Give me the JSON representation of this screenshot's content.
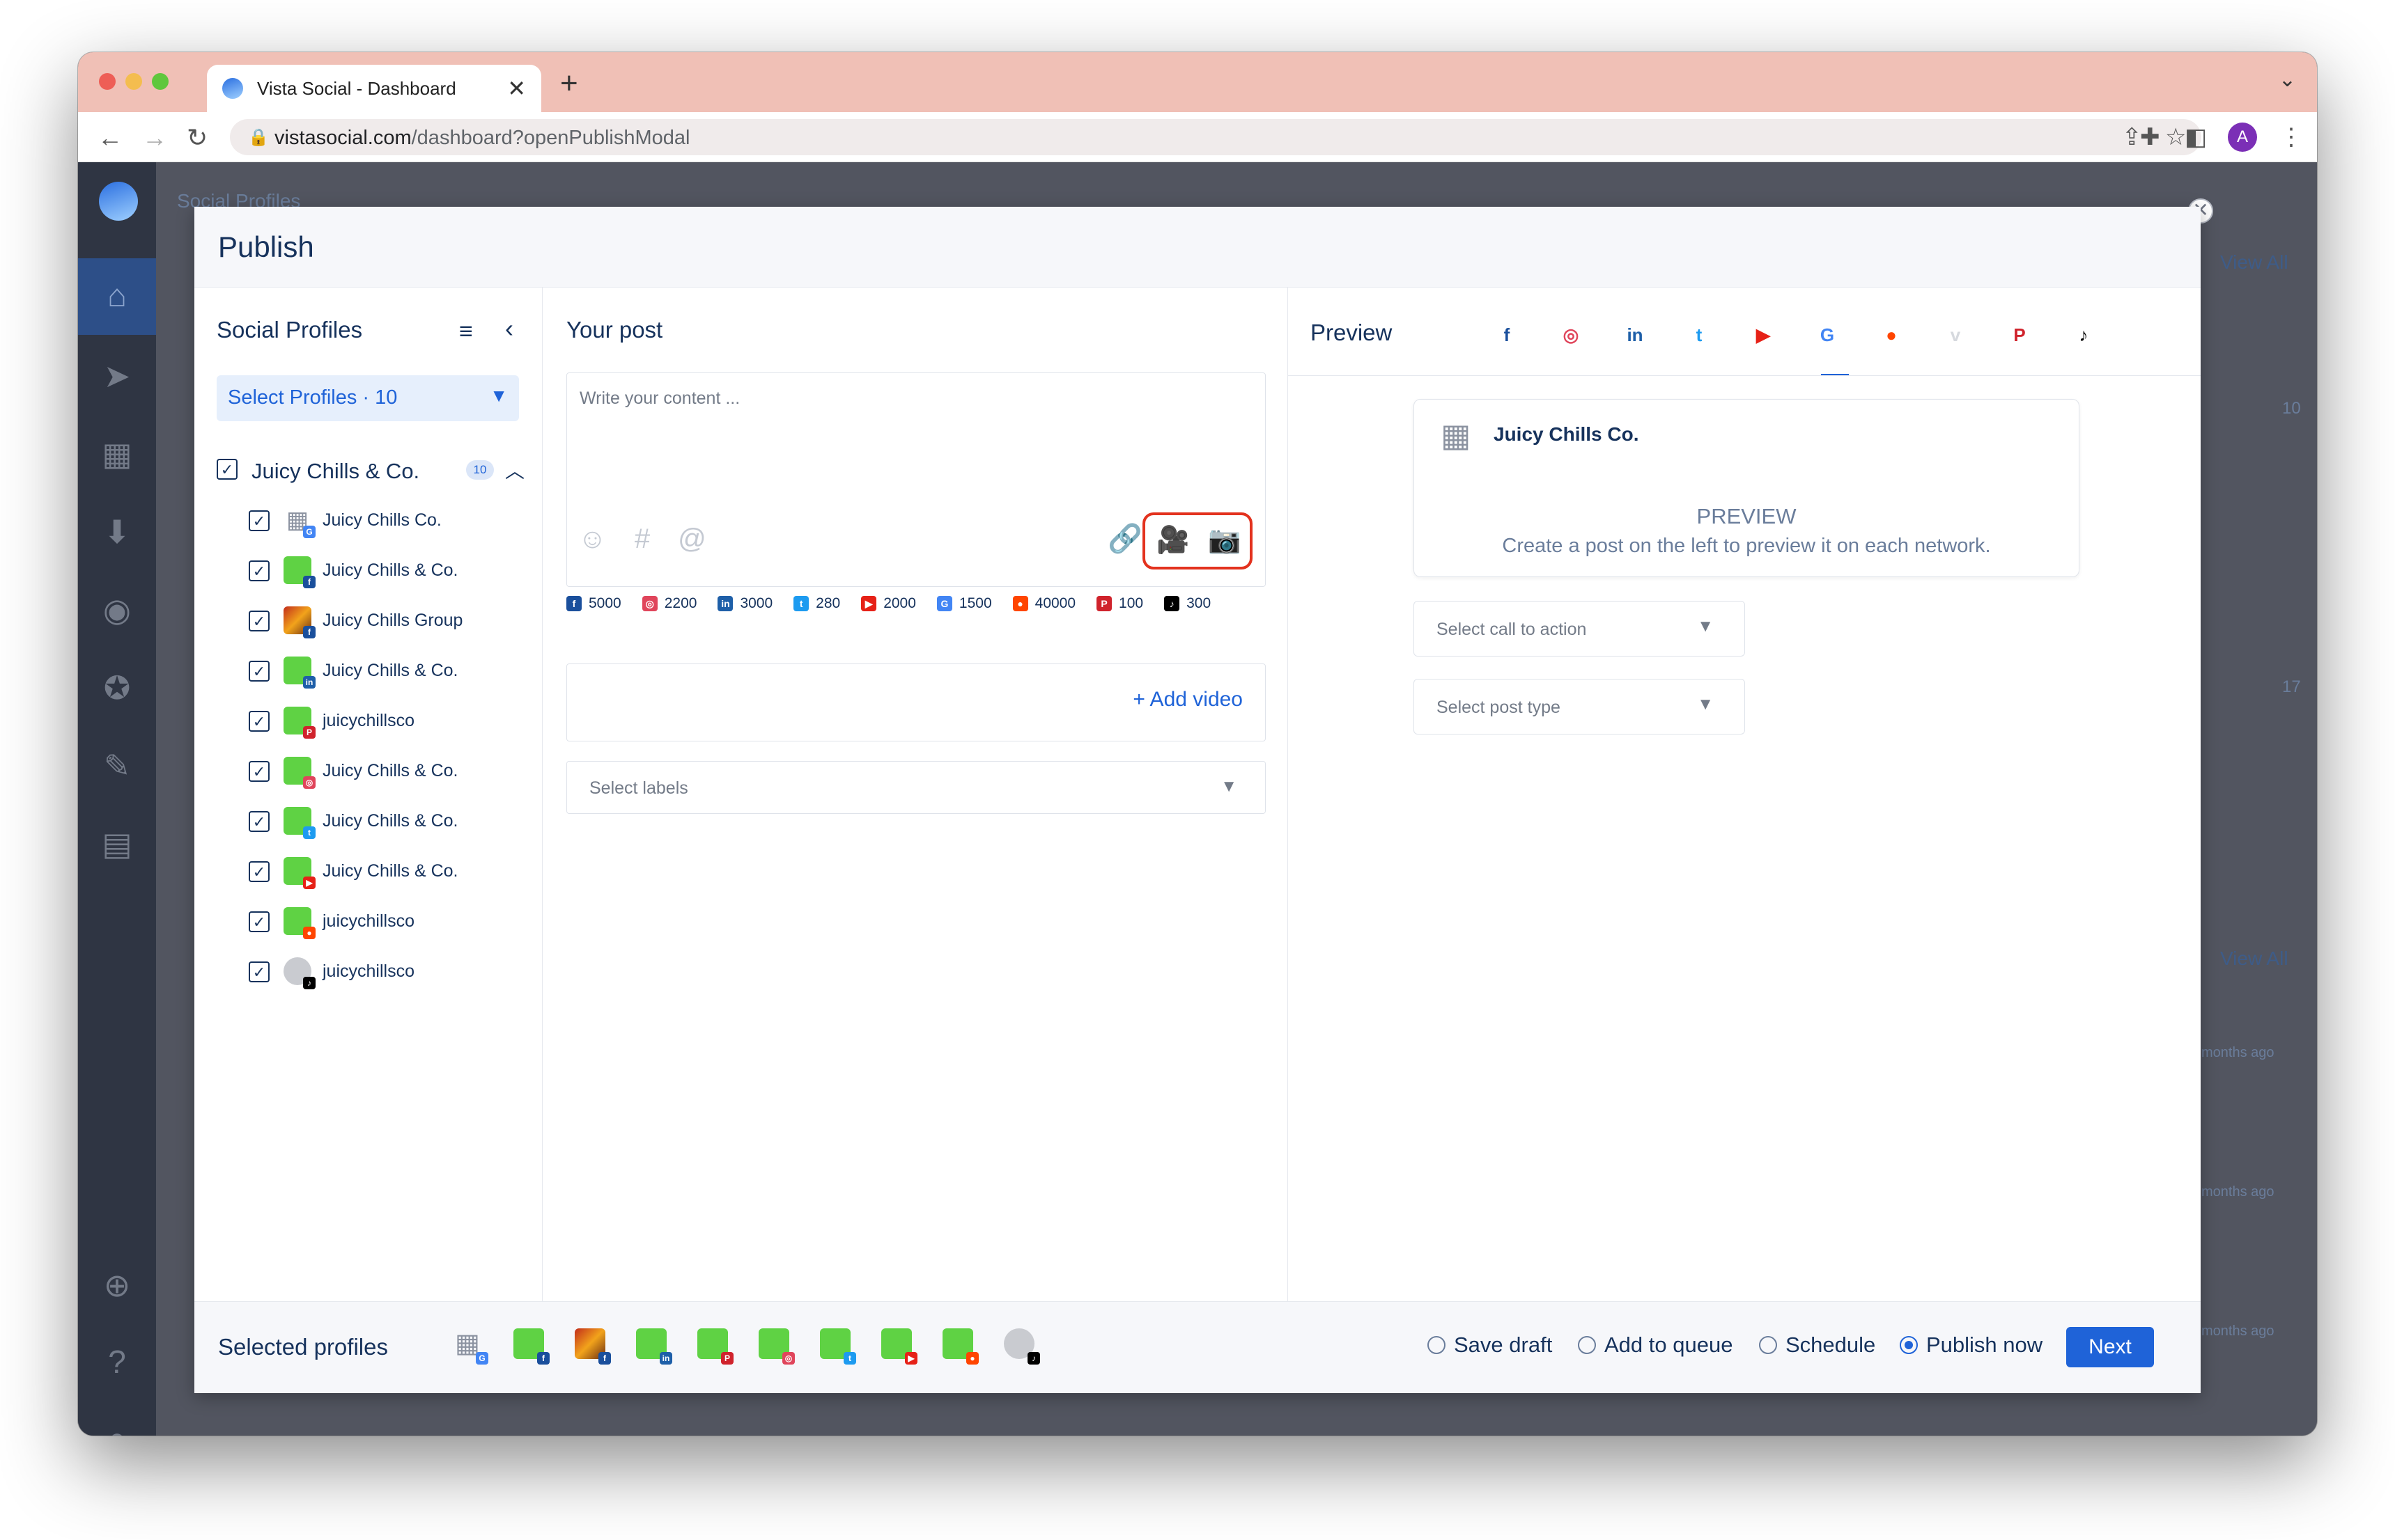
{
  "browser": {
    "tab_title": "Vista Social - Dashboard",
    "tab_close": "✕",
    "new_tab": "+",
    "url_host": "vistasocial.com",
    "url_path": "/dashboard?openPublishModal",
    "avatar_initial": "A",
    "traffic_colors": [
      "#ee5e56",
      "#f4bd4f",
      "#5fc73d"
    ]
  },
  "background": {
    "heading": "Social Profiles",
    "view_all_1": "View All",
    "view_all_2": "View All",
    "count_a": "10",
    "count_b": "17",
    "ago_1": "months ago",
    "ago_2": "months ago",
    "ago_3": "months ago"
  },
  "modal": {
    "title": "Publish",
    "close": "✕"
  },
  "profiles_panel": {
    "title": "Social Profiles",
    "select_label": "Select Profiles · 10",
    "group": {
      "name": "Juicy Chills & Co.",
      "count": "10"
    },
    "items": [
      {
        "name": "Juicy Chills Co.",
        "avatar": "building",
        "network": "google"
      },
      {
        "name": "Juicy Chills & Co.",
        "avatar": "green",
        "network": "facebook"
      },
      {
        "name": "Juicy Chills Group",
        "avatar": "photo",
        "network": "facebook"
      },
      {
        "name": "Juicy Chills & Co.",
        "avatar": "green",
        "network": "linkedin"
      },
      {
        "name": "juicychillsco",
        "avatar": "green",
        "network": "pinterest"
      },
      {
        "name": "Juicy Chills & Co.",
        "avatar": "green",
        "network": "instagram"
      },
      {
        "name": "Juicy Chills & Co.",
        "avatar": "green",
        "network": "twitter"
      },
      {
        "name": "Juicy Chills & Co.",
        "avatar": "green",
        "network": "youtube"
      },
      {
        "name": "juicychillsco",
        "avatar": "green",
        "network": "reddit"
      },
      {
        "name": "juicychillsco",
        "avatar": "gray",
        "network": "tiktok"
      }
    ]
  },
  "post_panel": {
    "title": "Your post",
    "placeholder": "Write your content ...",
    "char_limits": [
      {
        "network": "facebook",
        "value": "5000"
      },
      {
        "network": "instagram",
        "value": "2200"
      },
      {
        "network": "linkedin",
        "value": "3000"
      },
      {
        "network": "twitter",
        "value": "280"
      },
      {
        "network": "youtube",
        "value": "2000"
      },
      {
        "network": "google",
        "value": "1500"
      },
      {
        "network": "reddit",
        "value": "40000"
      },
      {
        "network": "pinterest",
        "value": "100"
      },
      {
        "network": "tiktok",
        "value": "300"
      }
    ],
    "add_video": "+  Add video",
    "labels_placeholder": "Select labels"
  },
  "preview_panel": {
    "title": "Preview",
    "networks": [
      "facebook",
      "instagram",
      "linkedin",
      "twitter",
      "youtube",
      "google",
      "reddit",
      "vimeo",
      "pinterest",
      "tiktok"
    ],
    "active_network": "google",
    "card_name": "Juicy Chills Co.",
    "card_label": "PREVIEW",
    "card_desc": "Create a post on the left to preview it on each network.",
    "cta_placeholder": "Select call to action",
    "post_type_placeholder": "Select post type"
  },
  "footer": {
    "label": "Selected profiles",
    "options": [
      "Save draft",
      "Add to queue",
      "Schedule",
      "Publish now"
    ],
    "selected_option": "Publish now",
    "next": "Next"
  },
  "colors": {
    "accent": "#1f63d8",
    "text": "#16325c",
    "highlight": "#e3321e",
    "facebook": "#1a4f9c",
    "instagram": "#e0455b",
    "linkedin": "#1e5fa8",
    "twitter": "#1d9bf0",
    "youtube": "#e62117",
    "google": "#4285f4",
    "reddit": "#ff4500",
    "vimeo": "#d6d9de",
    "pinterest": "#d0232c",
    "tiktok": "#000000"
  }
}
